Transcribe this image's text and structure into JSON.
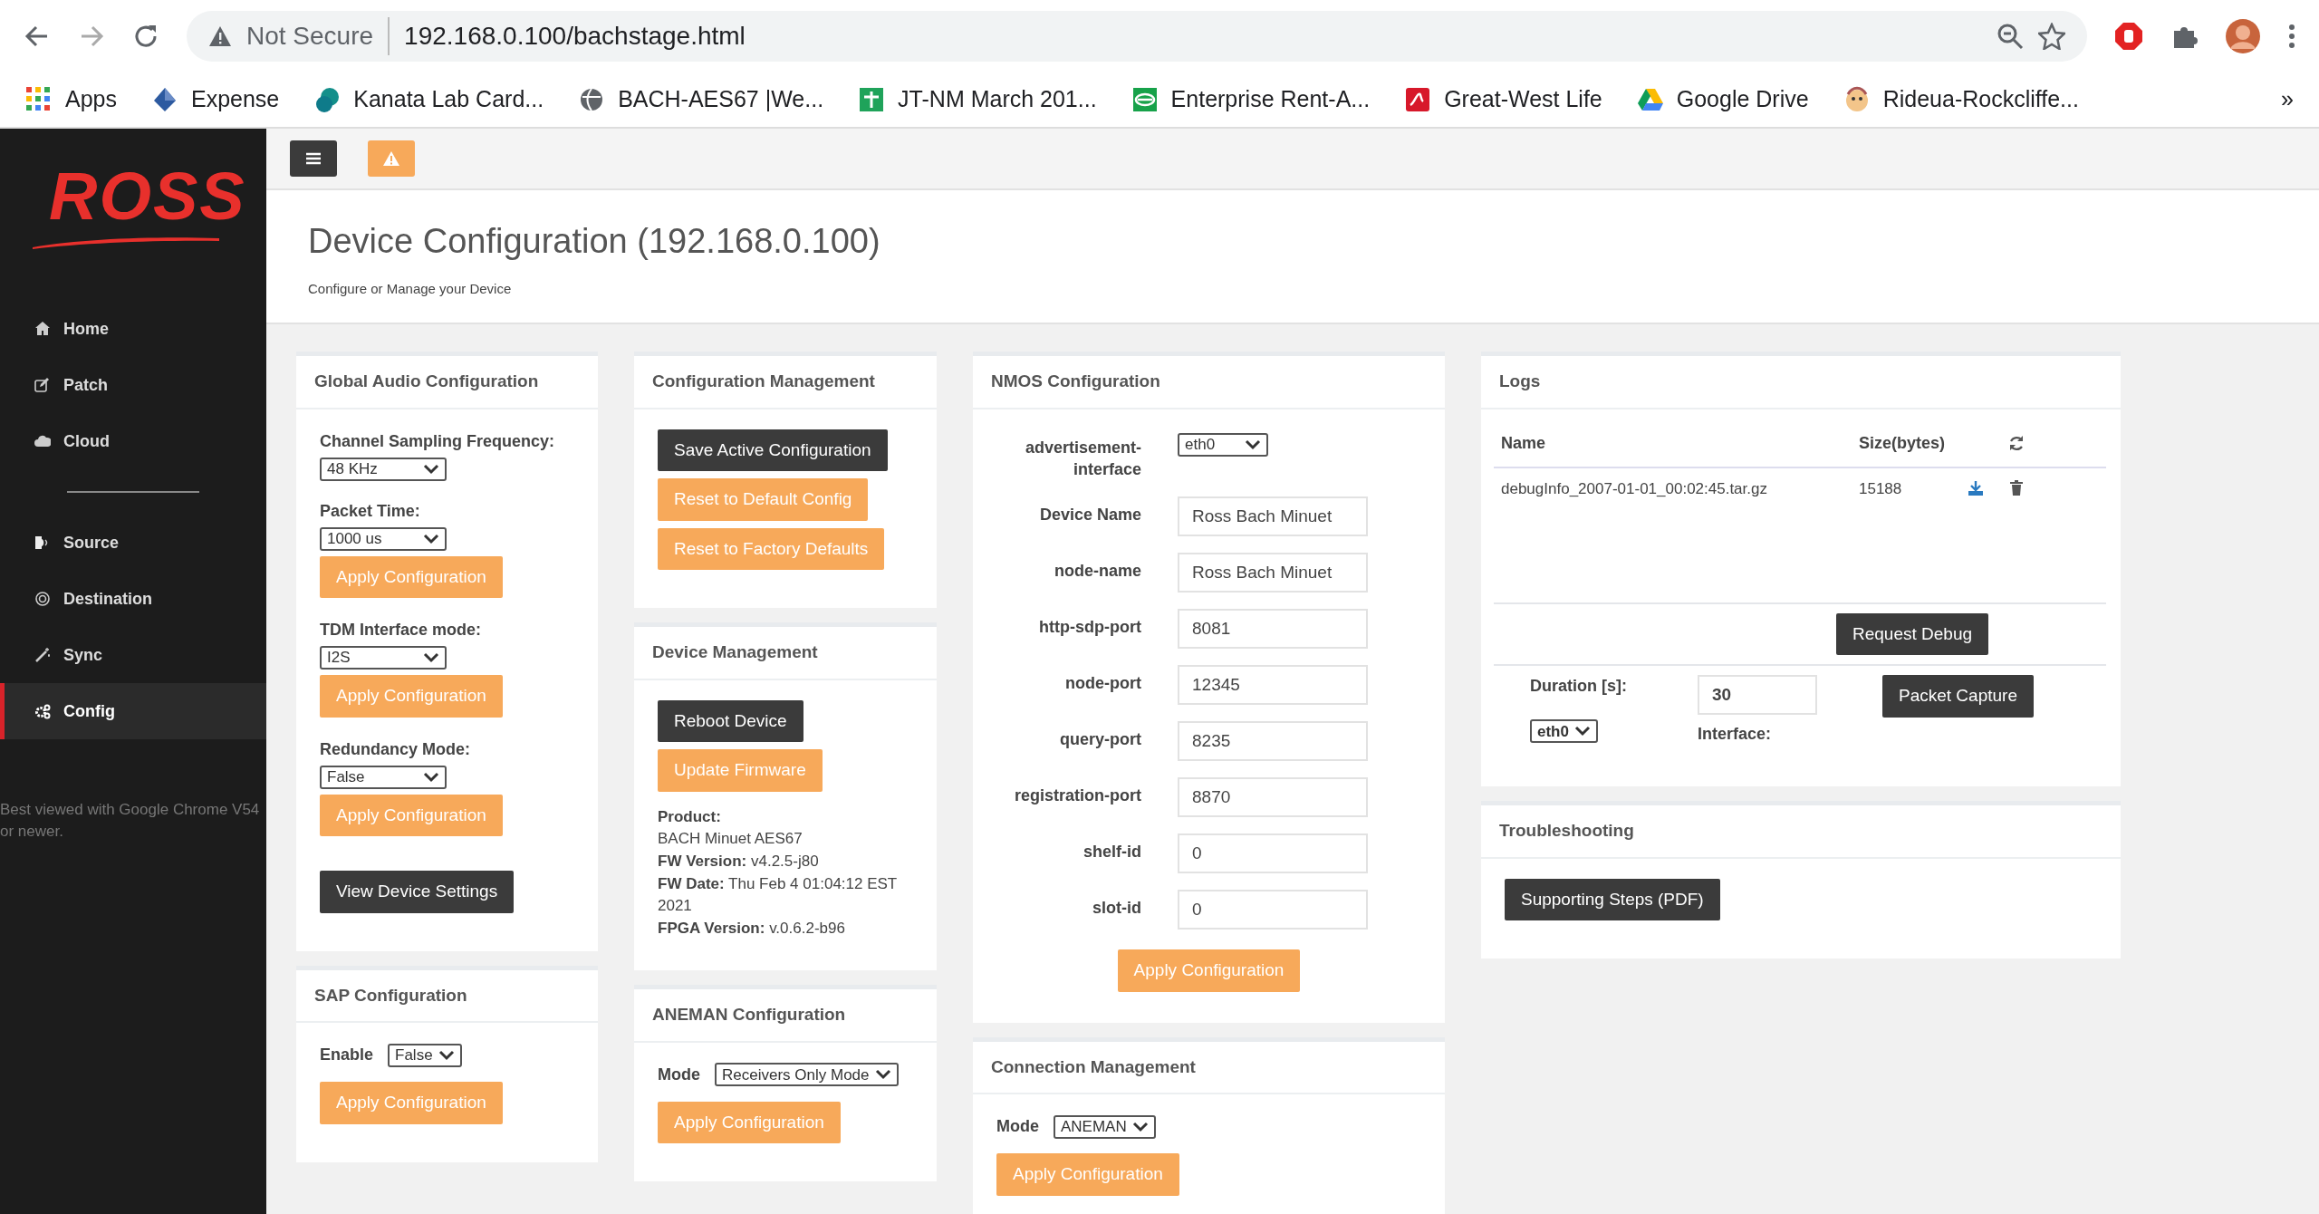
{
  "browser": {
    "security": "Not Secure",
    "url": "192.168.0.100/bachstage.html",
    "bookmarks": [
      "Apps",
      "Expense",
      "Kanata Lab Card...",
      "BACH-AES67 |We...",
      "JT-NM March 201...",
      "Enterprise Rent-A...",
      "Great-West Life",
      "Google Drive",
      "Rideua-Rockcliffe..."
    ],
    "overflow": "»"
  },
  "sidebar": {
    "logo": "ROSS",
    "groups": [
      [
        {
          "label": "Home",
          "selected": false
        },
        {
          "label": "Patch",
          "selected": false
        },
        {
          "label": "Cloud",
          "selected": false
        }
      ],
      [
        {
          "label": "Source",
          "selected": false
        },
        {
          "label": "Destination",
          "selected": false
        },
        {
          "label": "Sync",
          "selected": false
        },
        {
          "label": "Config",
          "selected": true
        }
      ]
    ],
    "note": "Best viewed with Google Chrome V54 or newer."
  },
  "header": {
    "title": "Device Configuration (192.168.0.100)",
    "subtitle": "Configure or Manage your Device"
  },
  "columns": [
    [
      {
        "title": "Global Audio Configuration",
        "items": [
          {
            "kind": "label",
            "text": "Channel Sampling Frequency:"
          },
          {
            "kind": "select",
            "value": "48 KHz"
          },
          {
            "kind": "label",
            "text": "Packet Time:"
          },
          {
            "kind": "select",
            "value": "1000 us"
          },
          {
            "kind": "button",
            "label": "Apply Configuration"
          },
          {
            "kind": "label",
            "text": "TDM Interface mode:"
          },
          {
            "kind": "select",
            "value": "I2S"
          },
          {
            "kind": "button",
            "label": "Apply Configuration"
          },
          {
            "kind": "label",
            "text": "Redundancy Mode:"
          },
          {
            "kind": "select",
            "value": "False"
          },
          {
            "kind": "button",
            "label": "Apply Configuration"
          },
          {
            "kind": "dark_button",
            "label": "View Device Settings"
          }
        ]
      },
      {
        "title": "SAP Configuration",
        "items": [
          {
            "kind": "inline_select",
            "label": "Enable",
            "value": "False"
          },
          {
            "kind": "button",
            "label": "Apply Configuration"
          }
        ]
      }
    ],
    [
      {
        "title": "Configuration Management",
        "items": [
          {
            "kind": "dark_button",
            "label": "Save Active Configuration"
          },
          {
            "kind": "button",
            "label": "Reset to Default Config"
          },
          {
            "kind": "button",
            "label": "Reset to Factory Defaults"
          }
        ]
      },
      {
        "title": "Device Management",
        "items": [
          {
            "kind": "dark_button",
            "label": "Reboot Device"
          },
          {
            "kind": "button",
            "label": "Update Firmware"
          },
          {
            "kind": "info",
            "lines": [
              "**Product:**",
              "BACH Minuet AES67",
              "**FW Version:** v4.2.5-j80",
              "**FW Date:** Thu Feb 4 01:04:12 EST 2021",
              "**FPGA Version:** v.0.6.2-b96"
            ]
          }
        ]
      },
      {
        "title": "ANEMAN Configuration",
        "items": [
          {
            "kind": "inline_select",
            "label": "Mode",
            "value": "Receivers Only Mode"
          },
          {
            "kind": "button",
            "label": "Apply Configuration"
          }
        ]
      }
    ],
    [
      {
        "title": "NMOS Configuration",
        "items": [
          {
            "kind": "select_row",
            "label": "advertisement-interface",
            "value": "eth0"
          },
          {
            "kind": "input_row",
            "label": "Device Name",
            "value": "Ross Bach Minuet"
          },
          {
            "kind": "input_row",
            "label": "node-name",
            "value": "Ross Bach Minuet"
          },
          {
            "kind": "input_row",
            "label": "http-sdp-port",
            "value": "8081"
          },
          {
            "kind": "input_row",
            "label": "node-port",
            "value": "12345"
          },
          {
            "kind": "input_row",
            "label": "query-port",
            "value": "8235"
          },
          {
            "kind": "input_row",
            "label": "registration-port",
            "value": "8870"
          },
          {
            "kind": "input_row",
            "label": "shelf-id",
            "value": "0"
          },
          {
            "kind": "input_row",
            "label": "slot-id",
            "value": "0"
          },
          {
            "kind": "center_button",
            "label": "Apply Configuration"
          }
        ]
      },
      {
        "title": "Connection Management",
        "items": [
          {
            "kind": "inline_select",
            "label": "Mode",
            "value": "ANEMAN"
          },
          {
            "kind": "button",
            "label": "Apply Configuration"
          }
        ]
      }
    ],
    [
      {
        "title": "Logs",
        "kind": "logs",
        "columns": [
          "Name",
          "Size(bytes)"
        ],
        "rows": [
          {
            "name": "debugInfo_2007-01-01_00:02:45.tar.gz",
            "size": "15188"
          }
        ],
        "request": "Request Debug",
        "duration_label": "Duration [s]:",
        "duration": "30",
        "interface_label": "Interface:",
        "interface": "eth0",
        "capture": "Packet Capture"
      },
      {
        "title": "Troubleshooting",
        "items": [
          {
            "kind": "dark_button",
            "label": "Supporting Steps (PDF)"
          }
        ]
      }
    ]
  ]
}
